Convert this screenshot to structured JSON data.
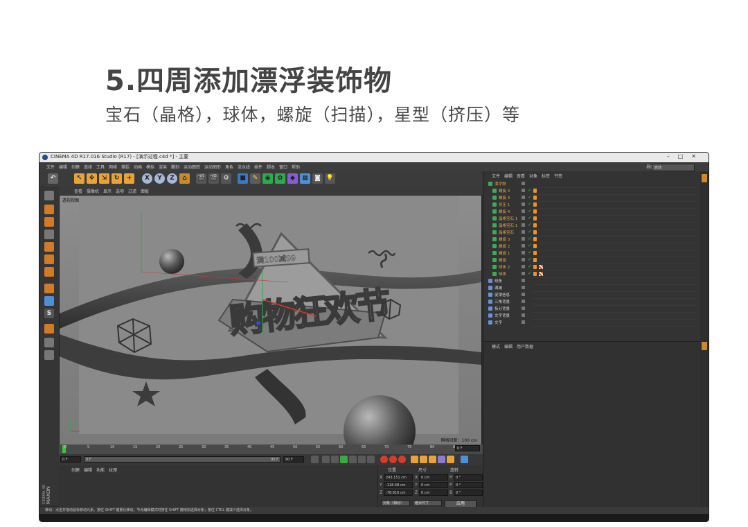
{
  "heading": "5.四周添加漂浮装饰物",
  "subheading": "宝石（晶格），球体，螺旋（扫描），星型（挤压）等",
  "window": {
    "title": "CINEMA 4D R17.016 Studio (R17) - [演示过程.c4d *] - 主要"
  },
  "menu": [
    "文件",
    "编辑",
    "创建",
    "选择",
    "工具",
    "网格",
    "捕捉",
    "动画",
    "模拟",
    "渲染",
    "雕刻",
    "运动跟踪",
    "运动图形",
    "角色",
    "流水线",
    "插件",
    "脚本",
    "窗口",
    "帮助"
  ],
  "layout_label": "界面",
  "layout_value": "启动",
  "viewport": {
    "menu": [
      "查看",
      "摄像机",
      "显示",
      "选项",
      "过滤",
      "面板"
    ],
    "label": "透视视图",
    "grid": "网格间距：100 cm",
    "headline_sign": "满100减99",
    "big_title": "购物狂欢节"
  },
  "timeline": {
    "ticks": [
      "0",
      "5",
      "10",
      "15",
      "20",
      "25",
      "30",
      "35",
      "40",
      "45",
      "50",
      "55",
      "60",
      "65",
      "70",
      "75",
      "80",
      "85",
      "90"
    ],
    "current_frame": "0 F",
    "start_field": "0 F",
    "min_field": "0 F",
    "max_field": "90 F",
    "end_field": "90 F"
  },
  "material": {
    "menu": [
      "创建",
      "编辑",
      "功能",
      "纹理"
    ]
  },
  "coords": {
    "headers": [
      "位置",
      "尺寸",
      "旋转"
    ],
    "rows": [
      {
        "axis": "X",
        "pos": "243.151 cm",
        "size_axis": "X",
        "size": "0 cm",
        "rot_axis": "H",
        "rot": "0 °"
      },
      {
        "axis": "Y",
        "pos": "-118.48 cm",
        "size_axis": "Y",
        "size": "0 cm",
        "rot_axis": "P",
        "rot": "0 °"
      },
      {
        "axis": "Z",
        "pos": "-78.916 cm",
        "size_axis": "Z",
        "size": "0 cm",
        "rot_axis": "B",
        "rot": "0 °"
      }
    ],
    "mode_object": "对象（相对）",
    "mode_size": "绝对尺寸",
    "apply": "应用"
  },
  "object_manager": {
    "menu": [
      "文件",
      "编辑",
      "查看",
      "对象",
      "标签",
      "书签"
    ],
    "rows": [
      {
        "name": "漂浮物",
        "color": "orange",
        "indent": 0
      },
      {
        "name": "螺旋 4",
        "color": "orange",
        "indent": 1
      },
      {
        "name": "螺旋 3",
        "color": "orange",
        "indent": 1
      },
      {
        "name": "挤压 1",
        "color": "orange",
        "indent": 1
      },
      {
        "name": "螺旋 4",
        "color": "orange",
        "indent": 1
      },
      {
        "name": "晶格宝石 1",
        "color": "orange",
        "indent": 1
      },
      {
        "name": "晶格宝石 1",
        "color": "orange",
        "indent": 1
      },
      {
        "name": "晶格宝石",
        "color": "orange",
        "indent": 1
      },
      {
        "name": "螺旋 3",
        "color": "orange",
        "indent": 1
      },
      {
        "name": "螺旋 2",
        "color": "orange",
        "indent": 1
      },
      {
        "name": "螺旋 1",
        "color": "orange",
        "indent": 1
      },
      {
        "name": "螺旋",
        "color": "orange",
        "indent": 1
      },
      {
        "name": "球体 2",
        "color": "orange",
        "indent": 1
      },
      {
        "name": "球体",
        "color": "orange",
        "indent": 1
      },
      {
        "name": "线条",
        "color": "plain",
        "indent": 0
      },
      {
        "name": "满减",
        "color": "plain",
        "indent": 0
      },
      {
        "name": "促销信息",
        "color": "plain",
        "indent": 0
      },
      {
        "name": "三角背景",
        "color": "plain",
        "indent": 0
      },
      {
        "name": "拆分背景",
        "color": "plain",
        "indent": 0
      },
      {
        "name": "文字背景",
        "color": "plain",
        "indent": 0
      },
      {
        "name": "文字",
        "color": "plain",
        "indent": 0
      }
    ]
  },
  "attribute_manager": {
    "menu": [
      "模式",
      "编辑",
      "用户数据"
    ]
  },
  "status": "移动：点击并拖动鼠标移动元素。按住 SHIFT 键量化移动；节点编辑模式时按住 SHIFT 键增加选择对象；按住 CTRL 键减少选择对象。",
  "colors": {
    "accent_orange": "#f0922b",
    "ui_dark": "#333333",
    "viewport_gray": "#888888"
  }
}
